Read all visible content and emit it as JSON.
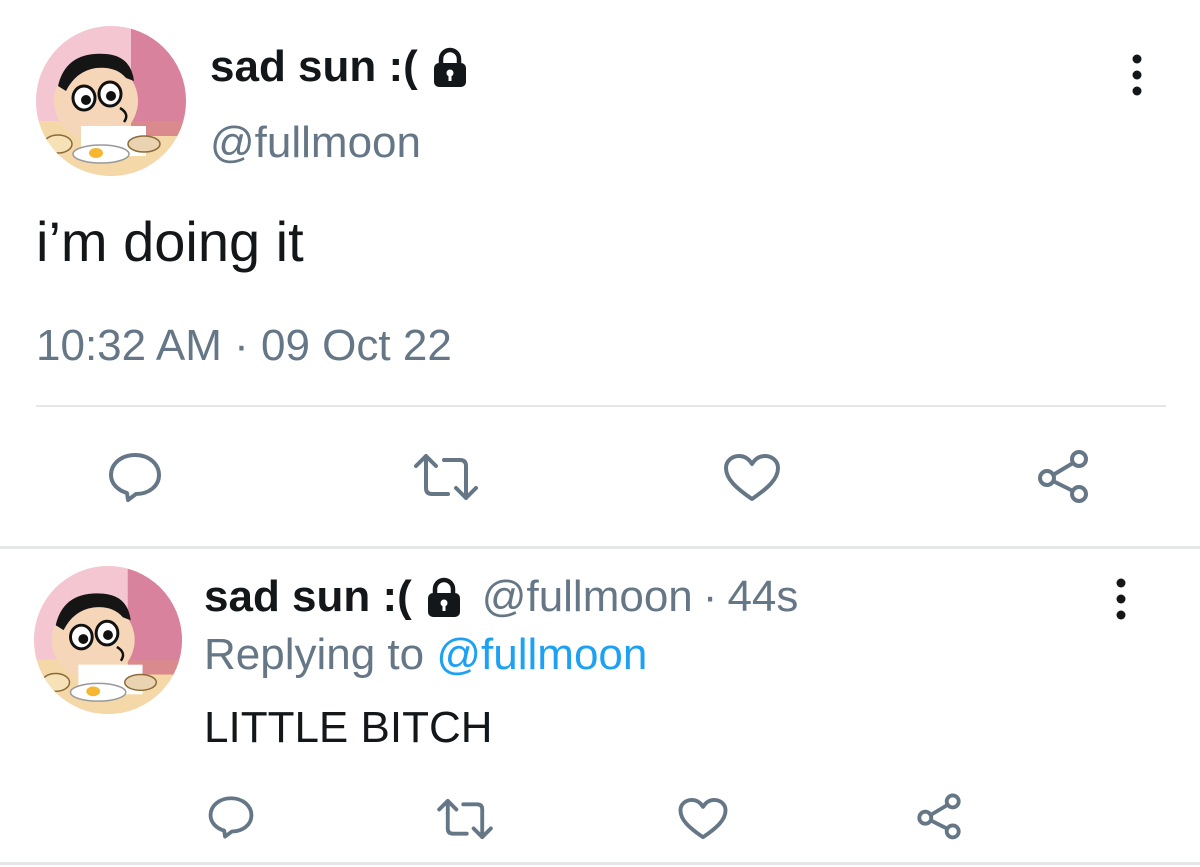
{
  "colors": {
    "text": "#14171a",
    "secondary": "#657786",
    "link": "#1da1f2",
    "divider": "#e3e7ea"
  },
  "main_tweet": {
    "display_name": "sad sun :(",
    "handle": "@fullmoon",
    "body": "i’m doing it",
    "timestamp": "10:32 AM · 09 Oct 22",
    "icons": [
      "lock-icon",
      "more-vertical-icon",
      "reply-icon",
      "retweet-icon",
      "like-icon",
      "share-icon"
    ]
  },
  "reply_tweet": {
    "display_name": "sad sun :(",
    "handle": "@fullmoon",
    "separator": "·",
    "age": "44s",
    "replying_prefix": "Replying to",
    "replying_handle": "@fullmoon",
    "body": "LITTLE BITCH",
    "icons": [
      "lock-icon",
      "more-vertical-icon",
      "reply-icon",
      "retweet-icon",
      "like-icon",
      "share-icon"
    ]
  }
}
